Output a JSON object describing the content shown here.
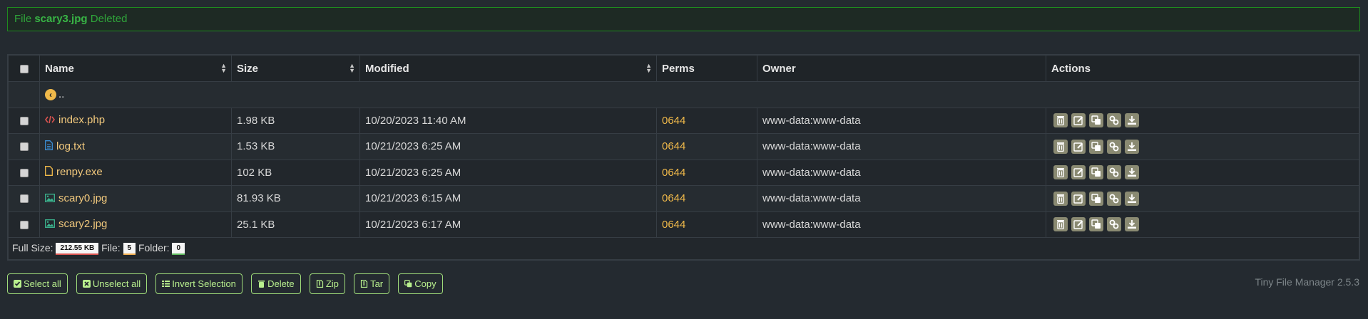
{
  "alert": {
    "prefix": "File",
    "filename": "scary3.jpg",
    "suffix": "Deleted"
  },
  "table": {
    "headers": {
      "name": "Name",
      "size": "Size",
      "modified": "Modified",
      "perms": "Perms",
      "owner": "Owner",
      "actions": "Actions"
    },
    "parent_label": "..",
    "rows": [
      {
        "name": "index.php",
        "icon": "code-file-icon",
        "size": "1.98 KB",
        "modified": "10/20/2023 11:40 AM",
        "perms": "0644",
        "owner": "www-data:www-data"
      },
      {
        "name": "log.txt",
        "icon": "text-file-icon",
        "size": "1.53 KB",
        "modified": "10/21/2023 6:25 AM",
        "perms": "0644",
        "owner": "www-data:www-data"
      },
      {
        "name": "renpy.exe",
        "icon": "file-icon",
        "size": "102 KB",
        "modified": "10/21/2023 6:25 AM",
        "perms": "0644",
        "owner": "www-data:www-data"
      },
      {
        "name": "scary0.jpg",
        "icon": "image-file-icon",
        "size": "81.93 KB",
        "modified": "10/21/2023 6:15 AM",
        "perms": "0644",
        "owner": "www-data:www-data"
      },
      {
        "name": "scary2.jpg",
        "icon": "image-file-icon",
        "size": "25.1 KB",
        "modified": "10/21/2023 6:17 AM",
        "perms": "0644",
        "owner": "www-data:www-data"
      }
    ],
    "footer": {
      "full_size_label": "Full Size:",
      "full_size_value": "212.55 KB",
      "file_label": "File:",
      "file_value": "5",
      "folder_label": "Folder:",
      "folder_value": "0"
    }
  },
  "buttons": {
    "select_all": "Select all",
    "unselect_all": "Unselect all",
    "invert_selection": "Invert Selection",
    "delete": "Delete",
    "zip": "Zip",
    "tar": "Tar",
    "copy": "Copy"
  },
  "brand": "Tiny File Manager 2.5.3",
  "colors": {
    "accent": "#b9f08e",
    "alert": "#2fa53a",
    "filename": "#f2c97d",
    "perms": "#f0b94a",
    "action_bg": "#8a8a72"
  }
}
